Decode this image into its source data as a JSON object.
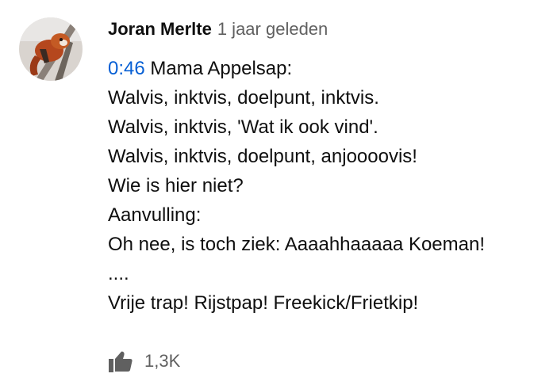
{
  "comment": {
    "author": "Joran Merlte",
    "published": "1 jaar geleden",
    "timestamp_link": "0:46",
    "first_line_rest": " Mama Appelsap:",
    "lines": [
      "Walvis, inktvis, doelpunt, inktvis.",
      "Walvis, inktvis, 'Wat ik ook vind'.",
      "Walvis, inktvis, doelpunt, anjoooovis!",
      "Wie is hier niet?",
      "Aanvulling:",
      "Oh nee, is toch ziek: Aaaahhaaaaa Koeman!",
      "....",
      "Vrije trap! Rijstpap! Freekick/Frietkip!"
    ],
    "like_count": "1,3K",
    "icons": {
      "like": "thumbs-up-icon",
      "avatar": "avatar"
    }
  },
  "colors": {
    "link": "#065fd4",
    "text": "#0f0f0f",
    "secondary": "#606060"
  }
}
